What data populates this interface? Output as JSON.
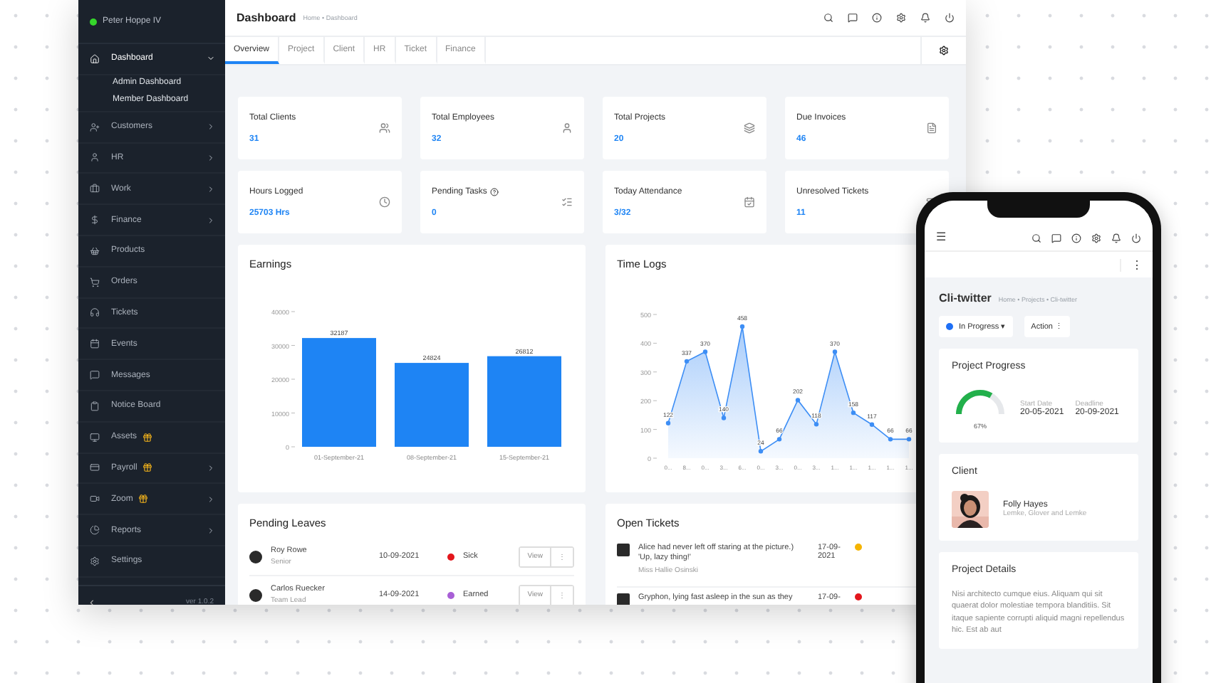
{
  "sidebar": {
    "user": {
      "name": "Peter Hoppe IV",
      "online": true
    },
    "items": [
      {
        "label": "Dashboard",
        "selected": true,
        "submenu": true,
        "expanded": true,
        "premium": false,
        "children": [
          {
            "label": "Admin Dashboard"
          },
          {
            "label": "Member Dashboard"
          }
        ]
      },
      {
        "label": "Customers",
        "selected": false,
        "submenu": true,
        "expanded": false,
        "premium": false
      },
      {
        "label": "HR",
        "selected": false,
        "submenu": true,
        "expanded": false,
        "premium": false
      },
      {
        "label": "Work",
        "selected": false,
        "submenu": true,
        "expanded": false,
        "premium": false
      },
      {
        "label": "Finance",
        "selected": false,
        "submenu": true,
        "expanded": false,
        "premium": false
      },
      {
        "label": "Products",
        "selected": false,
        "submenu": false,
        "expanded": false,
        "premium": false
      },
      {
        "label": "Orders",
        "selected": false,
        "submenu": false,
        "expanded": false,
        "premium": false
      },
      {
        "label": "Tickets",
        "selected": false,
        "submenu": false,
        "expanded": false,
        "premium": false
      },
      {
        "label": "Events",
        "selected": false,
        "submenu": false,
        "expanded": false,
        "premium": false
      },
      {
        "label": "Messages",
        "selected": false,
        "submenu": false,
        "expanded": false,
        "premium": false
      },
      {
        "label": "Notice Board",
        "selected": false,
        "submenu": false,
        "expanded": false,
        "premium": false
      },
      {
        "label": "Assets",
        "selected": false,
        "submenu": false,
        "expanded": false,
        "premium": true
      },
      {
        "label": "Payroll",
        "selected": false,
        "submenu": true,
        "expanded": false,
        "premium": true
      },
      {
        "label": "Zoom",
        "selected": false,
        "submenu": true,
        "expanded": false,
        "premium": true
      },
      {
        "label": "Reports",
        "selected": false,
        "submenu": true,
        "expanded": false,
        "premium": false
      },
      {
        "label": "Settings",
        "selected": false,
        "submenu": false,
        "expanded": false,
        "premium": false
      }
    ],
    "collapse": "‹",
    "version": "ver 1.0.2"
  },
  "header": {
    "title": "Dashboard",
    "breadcrumb": "Home • Dashboard"
  },
  "tabs": [
    {
      "label": "Overview",
      "selected": true
    },
    {
      "label": "Project",
      "selected": false
    },
    {
      "label": "Client",
      "selected": false
    },
    {
      "label": "HR",
      "selected": false
    },
    {
      "label": "Ticket",
      "selected": false
    },
    {
      "label": "Finance",
      "selected": false
    }
  ],
  "stats": [
    {
      "label": "Total Clients",
      "value": "31",
      "help": false
    },
    {
      "label": "Total Employees",
      "value": "32",
      "help": false
    },
    {
      "label": "Total Projects",
      "value": "20",
      "help": false
    },
    {
      "label": "Due Invoices",
      "value": "46",
      "help": false
    },
    {
      "label": "Hours Logged",
      "value": "25703 Hrs",
      "help": false
    },
    {
      "label": "Pending Tasks",
      "value": "0",
      "help": true
    },
    {
      "label": "Today Attendance",
      "value": "3/32",
      "help": false
    },
    {
      "label": "Unresolved Tickets",
      "value": "11",
      "help": false
    }
  ],
  "earnings": {
    "title": "Earnings",
    "chart_data": {
      "type": "bar",
      "categories": [
        "01-September-21",
        "08-September-21",
        "15-September-21"
      ],
      "series": [
        {
          "color": "#1e84f4",
          "values": [
            32187,
            24824,
            26812
          ]
        }
      ],
      "ylim": [
        0,
        40000
      ],
      "yticks": [
        0,
        10000,
        20000,
        30000,
        40000
      ],
      "data_labels": true
    }
  },
  "time_logs": {
    "title": "Time Logs",
    "chart_data": {
      "type": "area",
      "categories": [
        "0...",
        "8...",
        "0...",
        "3...",
        "6...",
        "0...",
        "3...",
        "0...",
        "3...",
        "1...",
        "1...",
        "1...",
        "1...",
        "1..."
      ],
      "series": [
        {
          "color": "#3d8ef5",
          "values": [
            122,
            337,
            370,
            140,
            458,
            24,
            66,
            202,
            118,
            370,
            158,
            117,
            66,
            66
          ]
        }
      ],
      "ylim": [
        0,
        500
      ],
      "yticks": [
        0,
        100,
        200,
        300,
        400,
        500
      ],
      "data_labels": true
    }
  },
  "pending_leaves": {
    "title": "Pending Leaves",
    "rows": [
      {
        "name": "Roy Rowe",
        "role": "Senior",
        "date": "10-09-2021",
        "type": "Sick",
        "color": "#e3161c",
        "view": "View",
        "more": "⋮"
      },
      {
        "name": "Carlos Ruecker",
        "role": "Team Lead",
        "date": "14-09-2021",
        "type": "Earned",
        "color": "#a85fd6",
        "view": "View",
        "more": "⋮"
      }
    ]
  },
  "open_tickets": {
    "title": "Open Tickets",
    "rows": [
      {
        "text": "Alice had never left off staring at the picture.) 'Up, lazy thing!'",
        "author": "Miss Hallie Osinski",
        "date": "17-09-2021",
        "color": "#f5b400"
      },
      {
        "text": "Gryphon, lying fast asleep in the sun as they",
        "date": "17-09-",
        "color": "#e3161c"
      }
    ]
  },
  "phone": {
    "menu": "☰",
    "more": "⋮",
    "title": "Cli-twitter",
    "breadcrumb": "Home • Projects • Cli-twitter",
    "status": {
      "label": "In Progress ▾",
      "color": "#1e6ff5"
    },
    "action": {
      "label": "Action",
      "more": "⋮"
    },
    "progress": {
      "title": "Project Progress",
      "percent": "67%",
      "start_label": "Start Date",
      "start": "20-05-2021",
      "deadline_label": "Deadline",
      "deadline": "20-09-2021"
    },
    "client": {
      "title": "Client",
      "name": "Folly Hayes",
      "company": "Lemke, Glover and Lemke"
    },
    "details": {
      "title": "Project Details",
      "text": "Nisi architecto cumque eius. Aliquam qui sit quaerat dolor molestiae tempora blanditiis. Sit itaque sapiente corrupti aliquid magni repellendus hic. Est ab aut"
    }
  }
}
